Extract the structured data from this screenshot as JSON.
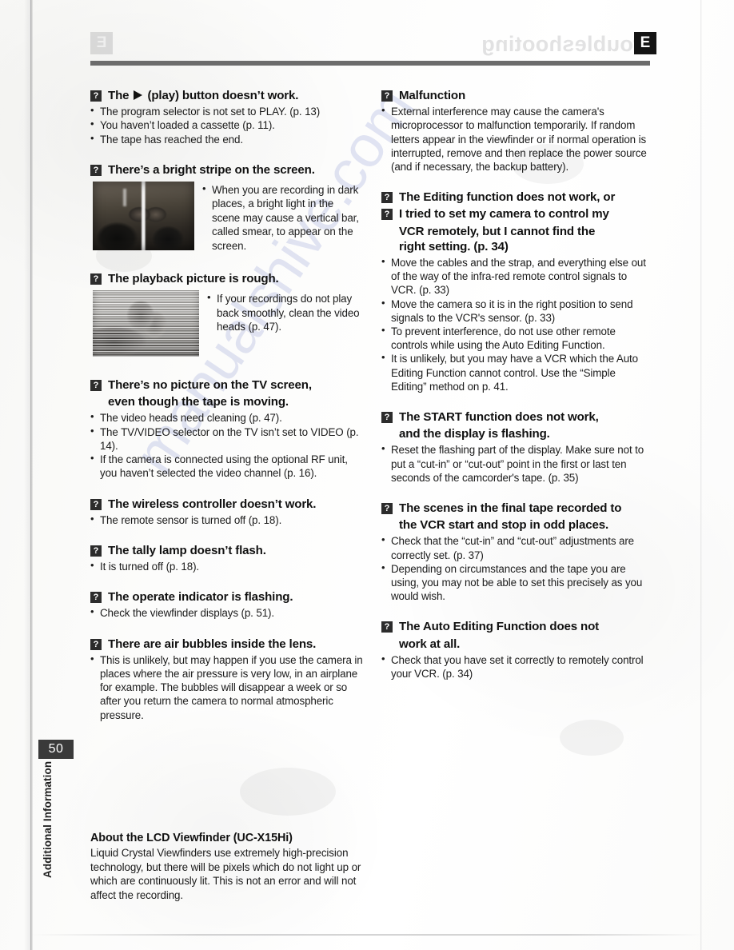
{
  "page": {
    "number": "50",
    "side_tab": "Additional Information",
    "language_badge": "E",
    "ghost_title": "Troubleshooting",
    "watermark": "manualshive.com"
  },
  "left_column": [
    {
      "id": "play-button",
      "marker": "?",
      "title_pre": "The",
      "icon": "play-triangle",
      "title_post": "(play) button doesn’t work.",
      "bullets": [
        "The program selector is not set to PLAY. (p. 13)",
        "You haven’t loaded a cassette (p. 11).",
        "The tape has reached the end."
      ]
    },
    {
      "id": "bright-stripe",
      "marker": "?",
      "title": "There’s a bright stripe on the screen.",
      "figure": "smear-photo",
      "bullets": [
        "When you are recording in dark places, a bright light in the scene may cause a vertical bar, called smear, to appear on the screen."
      ]
    },
    {
      "id": "playback-rough",
      "marker": "?",
      "title": "The playback picture is rough.",
      "figure": "noisy-photo",
      "bullets": [
        "If your recordings do not play back smoothly, clean the video heads (p. 47)."
      ]
    },
    {
      "id": "no-picture-tv",
      "marker": "?",
      "title": "There’s no picture on the TV screen,",
      "title_line2": "even though the tape is moving.",
      "bullets": [
        "The video heads need cleaning (p. 47).",
        "The TV/VIDEO selector on the TV isn’t set to VIDEO (p. 14).",
        "If the camera is connected using the optional RF unit, you haven’t selected the video channel (p. 16)."
      ]
    },
    {
      "id": "wireless-controller",
      "marker": "?",
      "title": "The wireless controller doesn’t work.",
      "bullets": [
        "The remote sensor is turned off (p. 18)."
      ]
    },
    {
      "id": "tally-lamp",
      "marker": "?",
      "title": "The tally lamp doesn’t flash.",
      "bullets": [
        "It is turned off (p. 18)."
      ]
    },
    {
      "id": "operate-indicator",
      "marker": "?",
      "title": "The operate indicator is flashing.",
      "bullets": [
        "Check the viewfinder displays (p. 51)."
      ]
    },
    {
      "id": "air-bubbles",
      "marker": "?",
      "title": "There are air bubbles inside the lens.",
      "bullets": [
        "This is unlikely, but may happen if you use the camera in places where the air pressure is very low, in an airplane for example.  The bubbles will disappear a week or so after you return the camera to normal atmospheric pressure."
      ]
    }
  ],
  "right_column": [
    {
      "id": "malfunction",
      "marker": "?",
      "title": "Malfunction",
      "bullets": [
        "External interference may cause the camera's microprocessor to malfunction temporarily. If random letters appear in the viewfinder or if normal operation is interrupted, remove and then replace the power source (and if necessary, the backup battery)."
      ]
    },
    {
      "id": "editing-function",
      "marker": "?",
      "marker2": "?",
      "title": "The Editing function does not work, or",
      "title2": "I tried to set my camera to control my",
      "title2_line2": "VCR remotely, but I cannot find the",
      "title2_line3": "right setting. (p. 34)",
      "bullets": [
        "Move the cables and the strap, and everything else out of the way of the infra-red remote control signals to VCR. (p. 33)",
        "Move the camera so it is in the right position to send signals to the VCR's sensor. (p. 33)",
        "To prevent interference, do not use other remote controls while using the Auto Editing Function.",
        "It is unlikely, but you may have a VCR which the Auto Editing Function cannot control. Use the “Simple Editing” method on p. 41."
      ]
    },
    {
      "id": "start-function",
      "marker": "?",
      "title": "The START function does not work,",
      "title_line2": "and the display is flashing.",
      "bullets": [
        "Reset the flashing part of the display. Make sure not to put a “cut-in” or “cut-out” point in the first or last ten seconds of the camcorder's tape. (p. 35)"
      ]
    },
    {
      "id": "scenes-odd-places",
      "marker": "?",
      "title": "The scenes in the final tape recorded to",
      "title_line2": "the VCR start and stop in odd places.",
      "bullets": [
        "Check that the “cut-in” and “cut-out” adjustments are correctly set. (p. 37)",
        "Depending on circumstances and the tape you are using, you may not be able to set this precisely as you would wish."
      ]
    },
    {
      "id": "auto-editing-no-work",
      "marker": "?",
      "title": "The Auto Editing Function does not",
      "title_line2": "work at all.",
      "bullets": [
        "Check that you have set it correctly to remotely control your VCR. (p. 34)"
      ]
    }
  ],
  "note": {
    "title": "About the LCD Viewfinder (UC-X15Hi)",
    "body": "Liquid Crystal Viewfinders use extremely high-precision technology, but there will be pixels which do not light up or which are continuously lit. This is not an error and will not affect the recording."
  }
}
